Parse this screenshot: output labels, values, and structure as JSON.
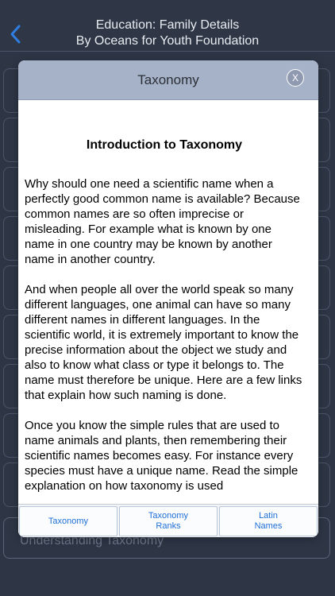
{
  "nav": {
    "title_line1": "Education: Family Details",
    "title_line2": "By Oceans for Youth Foundation"
  },
  "background": {
    "last_cell_label": "Understanding Taxonomy"
  },
  "modal": {
    "title": "Taxonomy",
    "close_label": "X",
    "article_title": "Introduction to Taxonomy",
    "paragraphs": [
      "Why should one need a scientific name when a perfectly good common name is available? Because common names are so often imprecise or misleading. For example what is known by one name in one country may be known by another name in another country.",
      "And when people all over the world speak so many different languages, one animal can have so many different names in different languages. In the scientific world, it is extremely important to know the precise information about the object we study and also to know what class or type it belongs to. The name must therefore be unique. Here are a few links that explain how such naming is done.",
      "Once you know the simple rules that are used to name animals and plants, then remembering their scientific names becomes easy. For instance every species must have a unique name. Read the simple explanation on how taxonomy is used"
    ],
    "tabs": [
      {
        "label": "Taxonomy"
      },
      {
        "label": "Taxonomy\nRanks"
      },
      {
        "label": "Latin\nNames"
      }
    ]
  },
  "colors": {
    "modal_header": "#a6b2c8",
    "tab_text": "#1e6fd6",
    "background": "#2e3646"
  }
}
